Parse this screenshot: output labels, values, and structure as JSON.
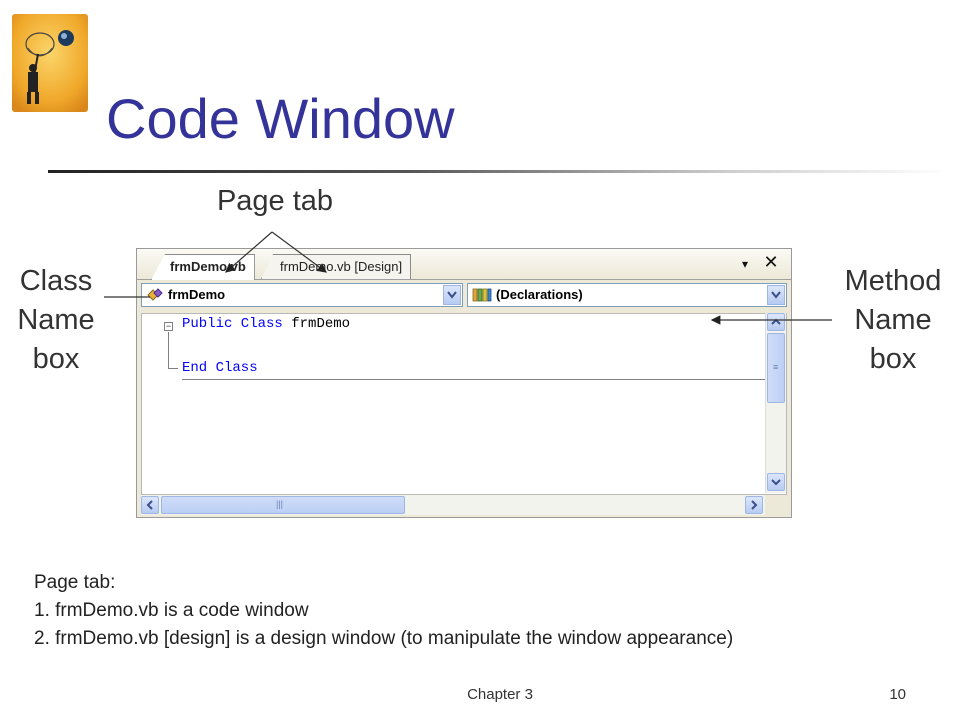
{
  "slide": {
    "title": "Code Window",
    "callouts": {
      "page_tab": "Page tab",
      "class_name_box": [
        "Class",
        "Name",
        "box"
      ],
      "method_name_box": [
        "Method",
        "Name",
        "box"
      ]
    },
    "notes": {
      "heading": "Page tab:",
      "items": [
        "1. frmDemo.vb is a code window",
        "2. frmDemo.vb [design] is a design window (to manipulate the window appearance)"
      ]
    },
    "footer": {
      "chapter": "Chapter 3",
      "page_number": "10"
    }
  },
  "ide": {
    "tabs": [
      {
        "label": "frmDemo.vb",
        "active": true
      },
      {
        "label": "frmDemo.vb [Design]",
        "active": false
      }
    ],
    "tab_menu_glyph": "▾",
    "tab_close_glyph": "✕",
    "class_name_combo": {
      "value": "frmDemo",
      "icon": "class-icon"
    },
    "method_name_combo": {
      "value": "(Declarations)",
      "icon": "declarations-icon"
    },
    "code": {
      "line1": {
        "keyword": "Public Class",
        "identifier": "frmDemo"
      },
      "line2": {
        "keyword": "End Class"
      }
    }
  },
  "colors": {
    "title": "#33339a",
    "keyword": "#0000ff",
    "ide_chrome": "#ece9d8",
    "scroll_button": "#b7cbf2"
  }
}
